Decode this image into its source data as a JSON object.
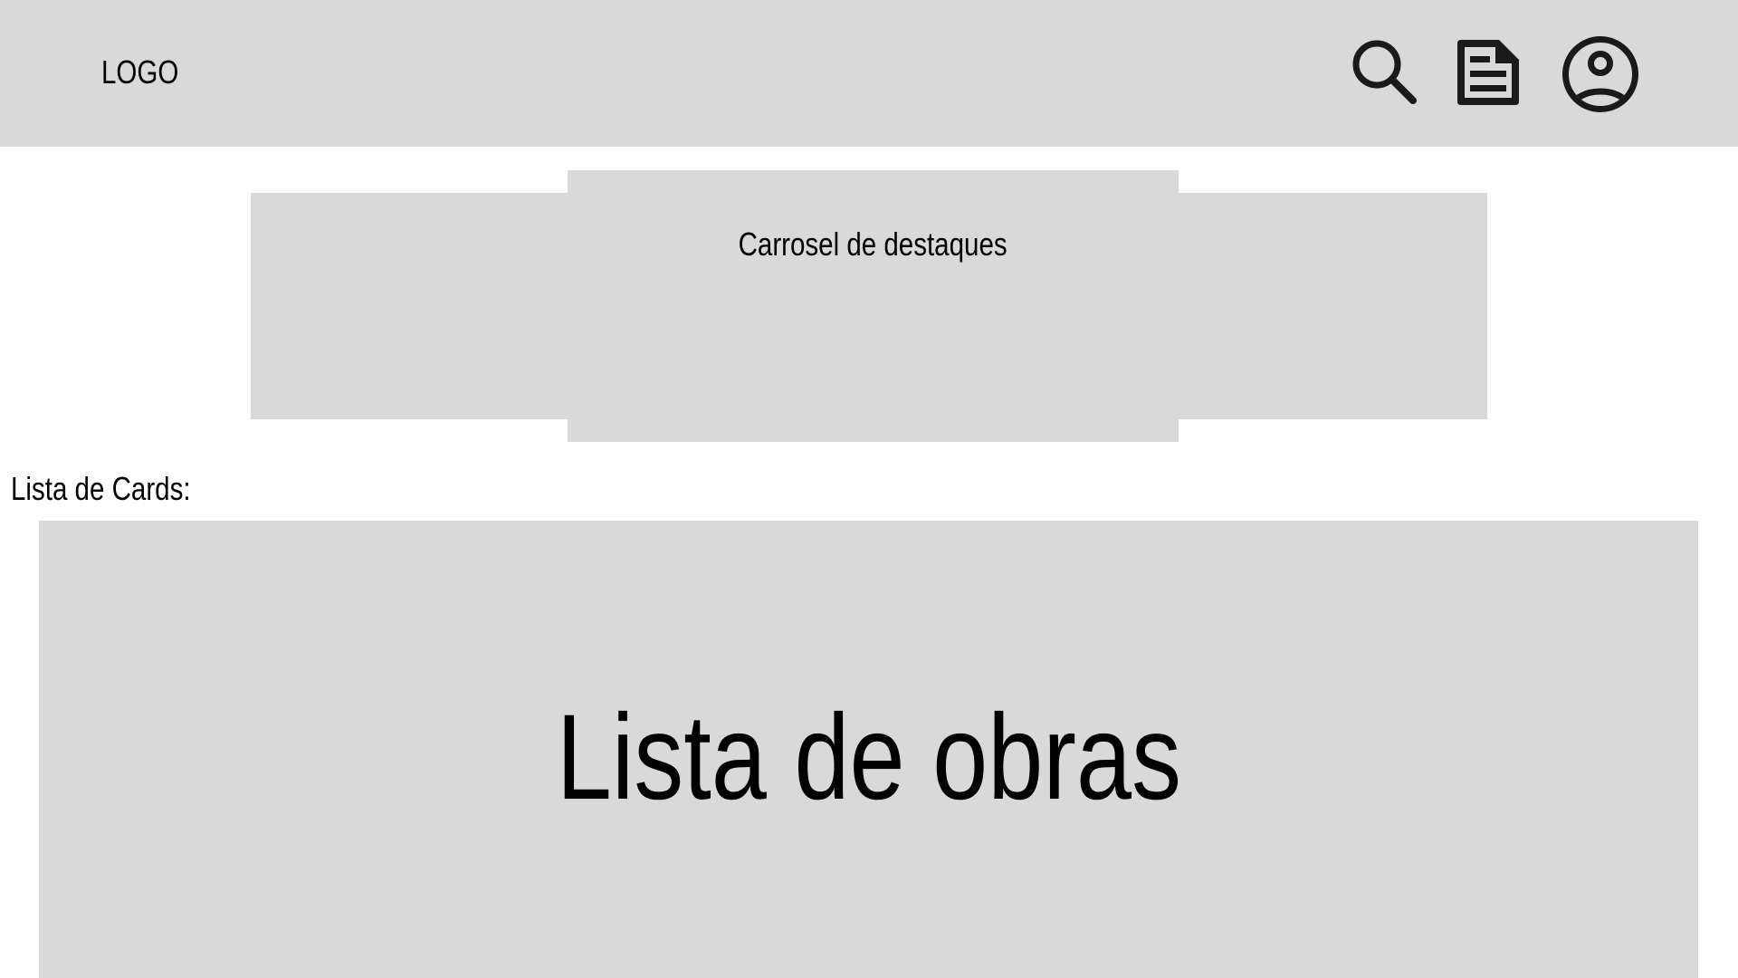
{
  "header": {
    "logo": "LOGO",
    "icons": {
      "search": "search-icon",
      "document": "document-icon",
      "profile": "user-profile-icon"
    },
    "background": "#d9d9d9",
    "icon_color": "#1a1a1a"
  },
  "carousel": {
    "label": "Carrosel de destaques",
    "background": "#d9d9d9"
  },
  "cards_section": {
    "label": "Lista de Cards:",
    "title": "Lista de obras",
    "background": "#d9d9d9"
  }
}
